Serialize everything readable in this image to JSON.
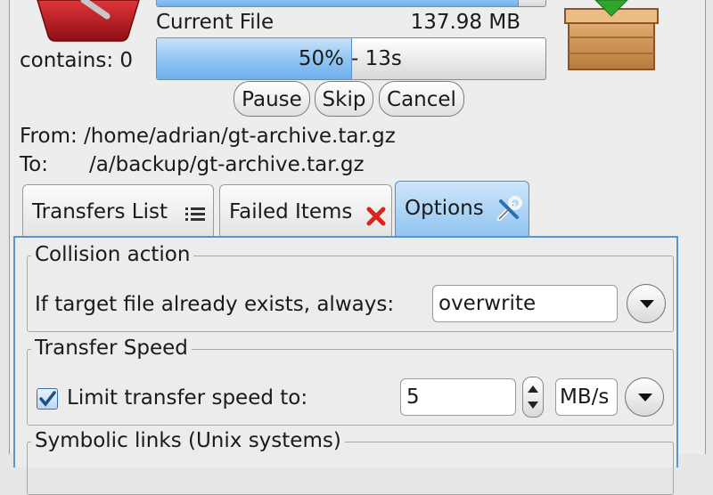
{
  "transfer": {
    "current_file_label": "Current File",
    "current_file_size": "137.98 MB",
    "overall_progress": 0.93,
    "file_progress": 0.5,
    "file_progress_label": "50%",
    "eta": "- 13s",
    "contains_label": "contains: 0",
    "from_line": "From: /home/adrian/gt-archive.tar.gz",
    "to_label": "To:",
    "to_path": "/a/backup/gt-archive.tar.gz"
  },
  "buttons": {
    "pause": "Pause",
    "skip": "Skip",
    "cancel": "Cancel"
  },
  "tabs": [
    {
      "label": "Transfers List",
      "icon": "list-icon"
    },
    {
      "label": "Failed Items",
      "icon": "red-x-icon"
    },
    {
      "label": "Options",
      "icon": "wrench-screwdriver-icon",
      "active": true
    }
  ],
  "options": {
    "collision": {
      "legend": "Collision action",
      "label": "If target file already exists, always:",
      "value": "overwrite"
    },
    "speed": {
      "legend": "Transfer Speed",
      "checkbox_label": "Limit transfer speed to:",
      "checked": true,
      "value": "5",
      "unit": "MB/s"
    },
    "symlinks": {
      "legend": "Symbolic links (Unix systems)"
    }
  },
  "colors": {
    "accent": "#5a94cf",
    "progress": "#8ec4f2",
    "danger": "#d9261c"
  }
}
